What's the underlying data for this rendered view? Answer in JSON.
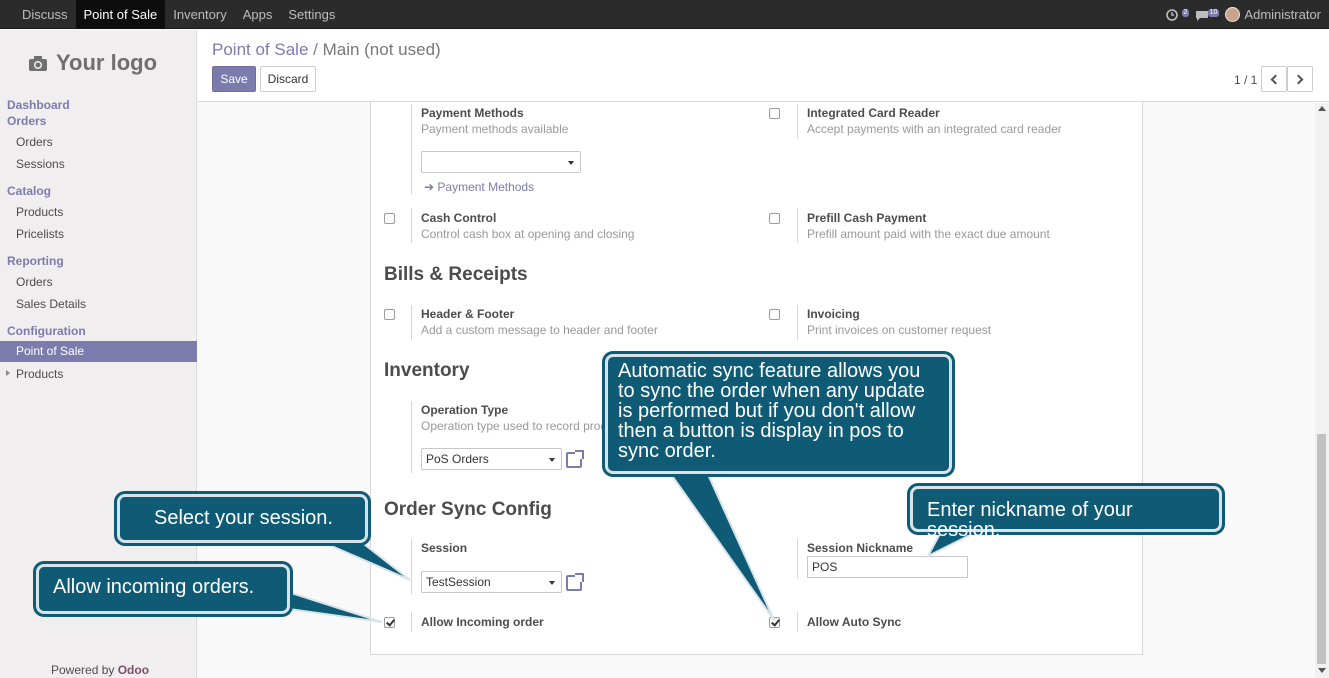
{
  "topbar": {
    "menu": [
      "Discuss",
      "Point of Sale",
      "Inventory",
      "Apps",
      "Settings"
    ],
    "active": "Point of Sale",
    "activity_badge": "2",
    "messages_badge": "10",
    "user": "Administrator"
  },
  "sidebar": {
    "logo": "Your logo",
    "dashboard": "Dashboard",
    "orders_head": "Orders",
    "orders_items": [
      "Orders",
      "Sessions"
    ],
    "catalog_head": "Catalog",
    "catalog_items": [
      "Products",
      "Pricelists"
    ],
    "reporting_head": "Reporting",
    "reporting_items": [
      "Orders",
      "Sales Details"
    ],
    "configuration_head": "Configuration",
    "configuration_items": [
      "Point of Sale",
      "Products"
    ],
    "powered_by": "Powered by",
    "powered_brand": "Odoo"
  },
  "control_panel": {
    "breadcrumb_parent": "Point of Sale /",
    "breadcrumb_current": "Main (not used)",
    "save": "Save",
    "discard": "Discard",
    "pager": "1 / 1"
  },
  "form": {
    "payment_methods_label": "Payment Methods",
    "payment_methods_desc": "Payment methods available",
    "payment_methods_link": "Payment Methods",
    "integrated_card_label": "Integrated Card Reader",
    "integrated_card_desc": "Accept payments with an integrated card reader",
    "cash_control_label": "Cash Control",
    "cash_control_desc": "Control cash box at opening and closing",
    "prefill_label": "Prefill Cash Payment",
    "prefill_desc": "Prefill amount paid with the exact due amount",
    "bills_heading": "Bills & Receipts",
    "header_footer_label": "Header & Footer",
    "header_footer_desc": "Add a custom message to header and footer",
    "invoicing_label": "Invoicing",
    "invoicing_desc": "Print invoices on customer request",
    "inventory_heading": "Inventory",
    "operation_type_label": "Operation Type",
    "operation_type_desc": "Operation type used to record prod",
    "operation_type_value": "PoS Orders",
    "sync_heading": "Order Sync Config",
    "session_label": "Session",
    "session_value": "TestSession",
    "session_nickname_label": "Session Nickname",
    "session_nickname_value": "POS",
    "allow_incoming_label": "Allow Incoming order",
    "allow_auto_sync_label": "Allow Auto Sync"
  },
  "callouts": {
    "auto_sync": [
      "Automatic sync feature allows you",
      "to sync the order when any update",
      "is performed but if you don't allow",
      "then a button is display in pos to",
      "sync order."
    ],
    "select_session": "Select your session.",
    "allow_incoming": "Allow incoming orders.",
    "nickname": "Enter nickname of your session."
  },
  "colors": {
    "brand": "#7c7bad",
    "topbar": "#2b2b2b",
    "callout": "#0f5a74"
  }
}
